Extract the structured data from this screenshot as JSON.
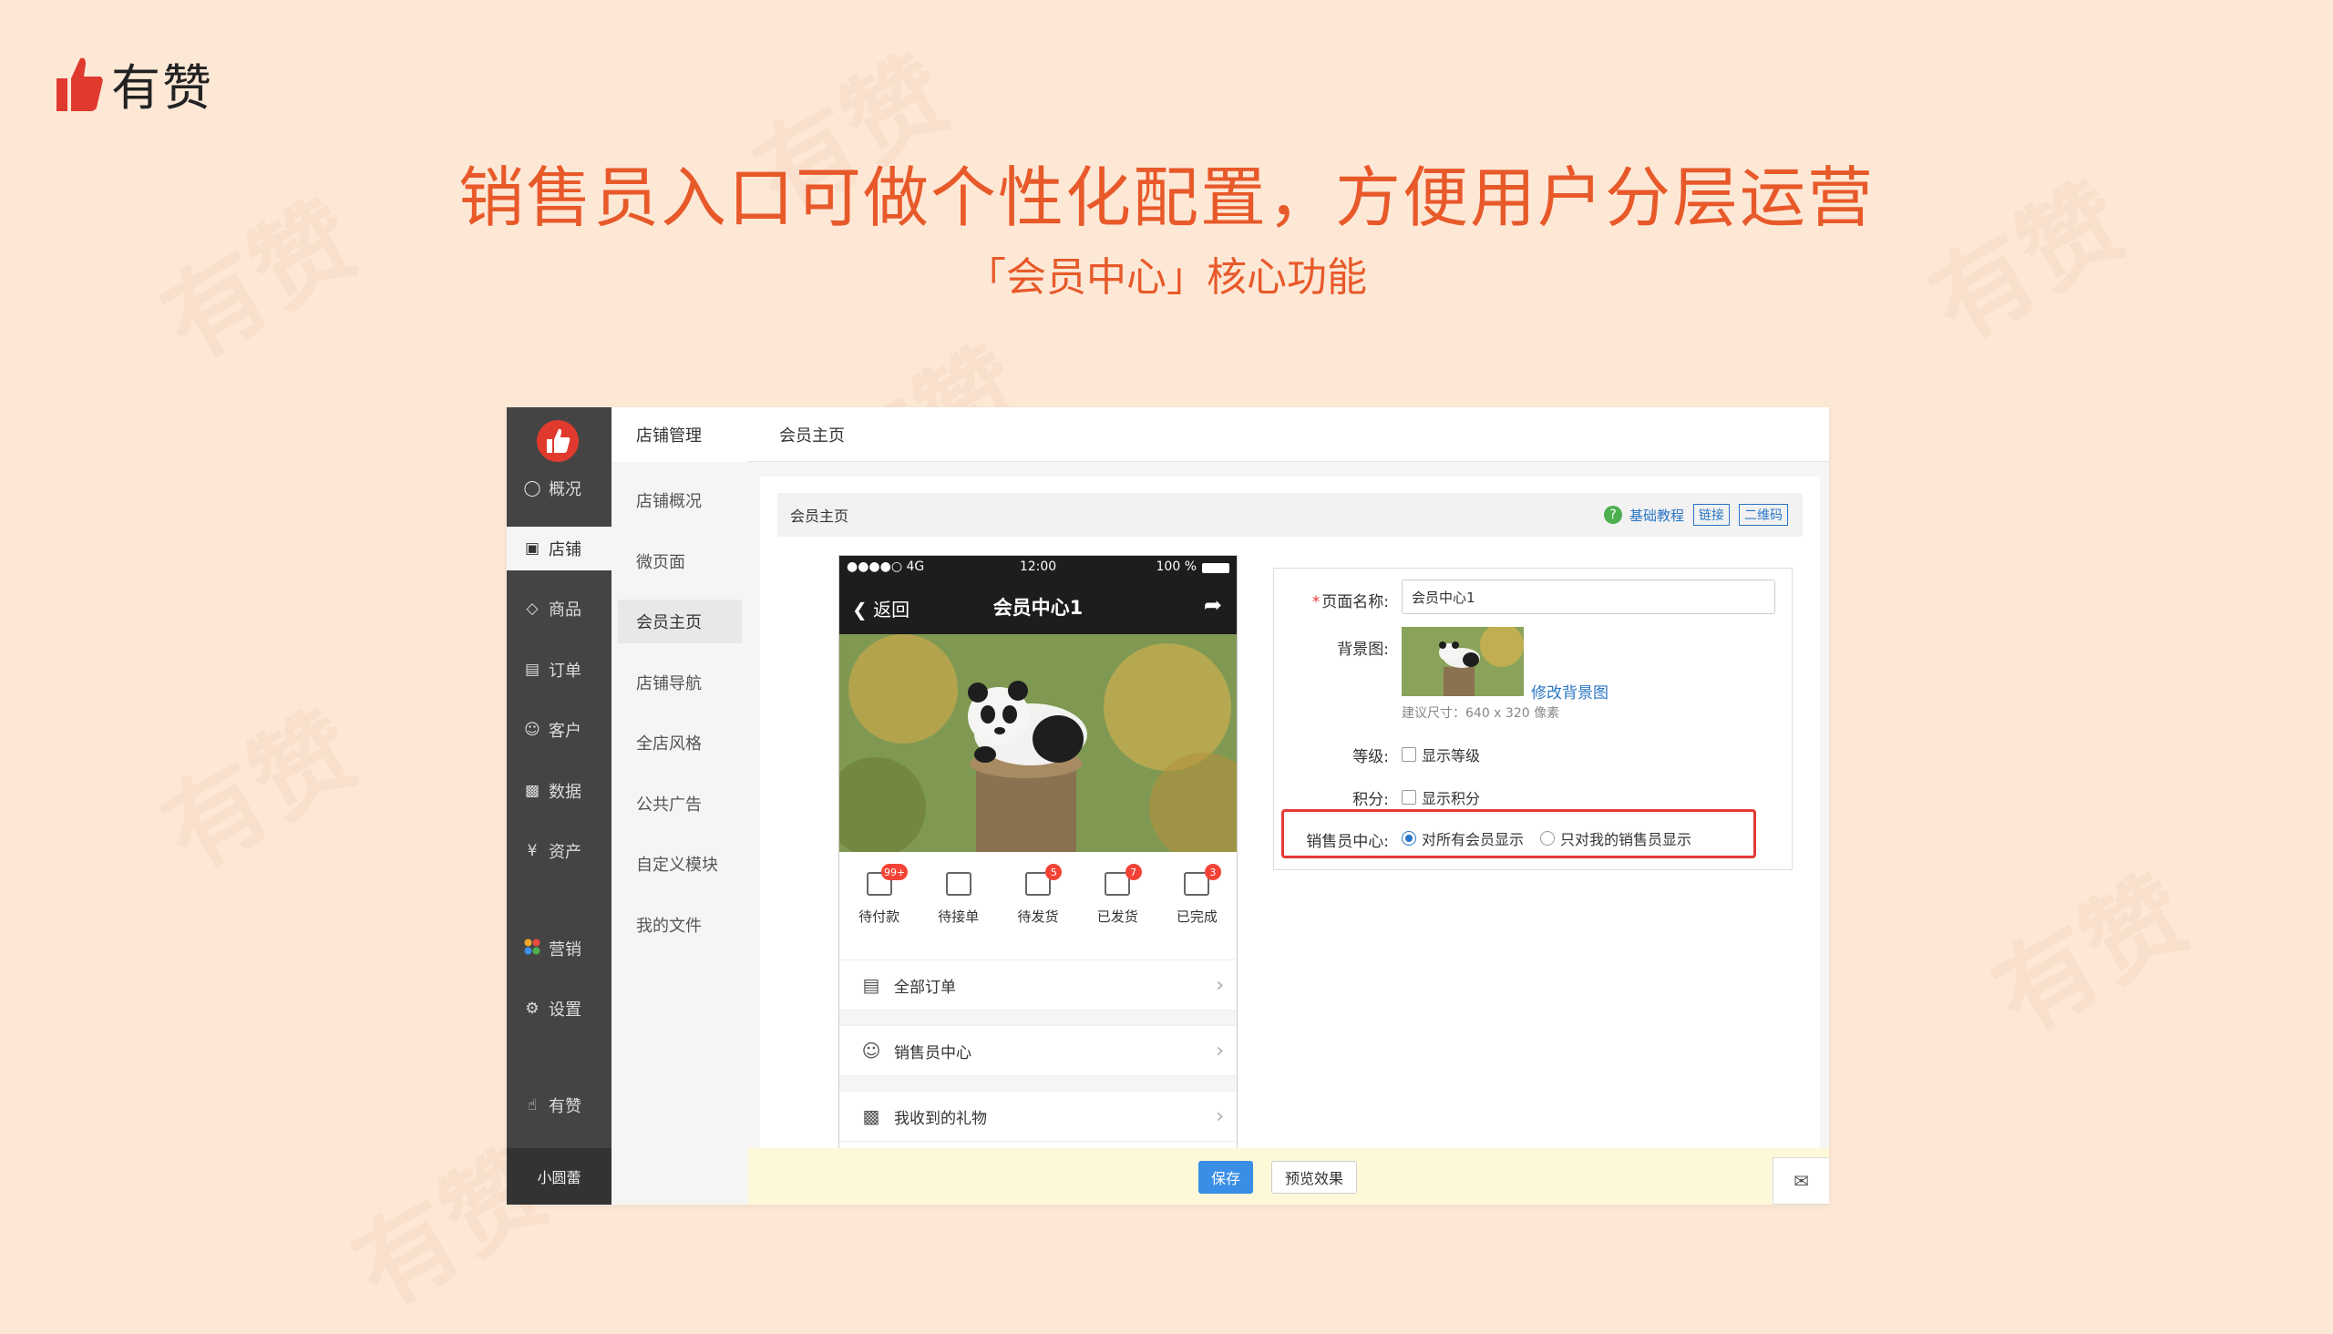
{
  "brand": {
    "name": "有赞",
    "accent": "#e03a2e"
  },
  "headline": "销售员入口可做个性化配置，方便用户分层运营",
  "subline": "「会员中心」核心功能",
  "watermark": "有赞",
  "app": {
    "sidebar": {
      "items": [
        {
          "label": "概况",
          "icon": "chat-icon"
        },
        {
          "label": "店铺",
          "icon": "store-icon",
          "active": true
        },
        {
          "label": "商品",
          "icon": "tag-icon"
        },
        {
          "label": "订单",
          "icon": "list-icon"
        },
        {
          "label": "客户",
          "icon": "user-icon"
        },
        {
          "label": "数据",
          "icon": "bar-chart-icon"
        },
        {
          "label": "资产",
          "icon": "yen-icon"
        },
        {
          "label": "营销",
          "icon": "apps-icon"
        },
        {
          "label": "设置",
          "icon": "gear-icon"
        },
        {
          "label": "有赞",
          "icon": "thumb-up-icon"
        }
      ],
      "shop_name": "小圆蕾"
    },
    "subnav": {
      "title": "店铺管理",
      "items": [
        "店铺概况",
        "微页面",
        "会员主页",
        "店铺导航",
        "全店风格",
        "公共广告",
        "自定义模块",
        "我的文件"
      ],
      "active": "会员主页"
    },
    "header": {
      "title": "会员主页"
    },
    "card": {
      "bar_title": "会员主页",
      "links": {
        "tutorial": "基础教程",
        "link": "链接",
        "qrcode": "二维码"
      }
    },
    "phone": {
      "status": {
        "signal": "●●●●○ 4G",
        "time": "12:00",
        "battery": "100 %"
      },
      "nav": {
        "back": "返回",
        "title": "会员中心1"
      },
      "orders": [
        {
          "label": "待付款",
          "badge": "99+"
        },
        {
          "label": "待接单",
          "badge": ""
        },
        {
          "label": "待发货",
          "badge": "5"
        },
        {
          "label": "已发货",
          "badge": "7"
        },
        {
          "label": "已完成",
          "badge": "3"
        }
      ],
      "rows": [
        {
          "label": "全部订单",
          "icon": "document-icon"
        },
        {
          "label": "销售员中心",
          "icon": "person-location-icon"
        },
        {
          "label": "我收到的礼物",
          "icon": "gift-icon"
        }
      ]
    },
    "form": {
      "page_name_label": "页面名称:",
      "page_name_value": "会员中心1",
      "bg_label": "背景图:",
      "modify_bg": "修改背景图",
      "size_hint": "建议尺寸：640 x 320 像素",
      "level_label": "等级:",
      "level_option": "显示等级",
      "points_label": "积分:",
      "points_option": "显示积分",
      "sales_label": "销售员中心:",
      "sales_option_all": "对所有会员显示",
      "sales_option_mine": "只对我的销售员显示"
    },
    "footer": {
      "save": "保存",
      "preview": "预览效果"
    }
  }
}
